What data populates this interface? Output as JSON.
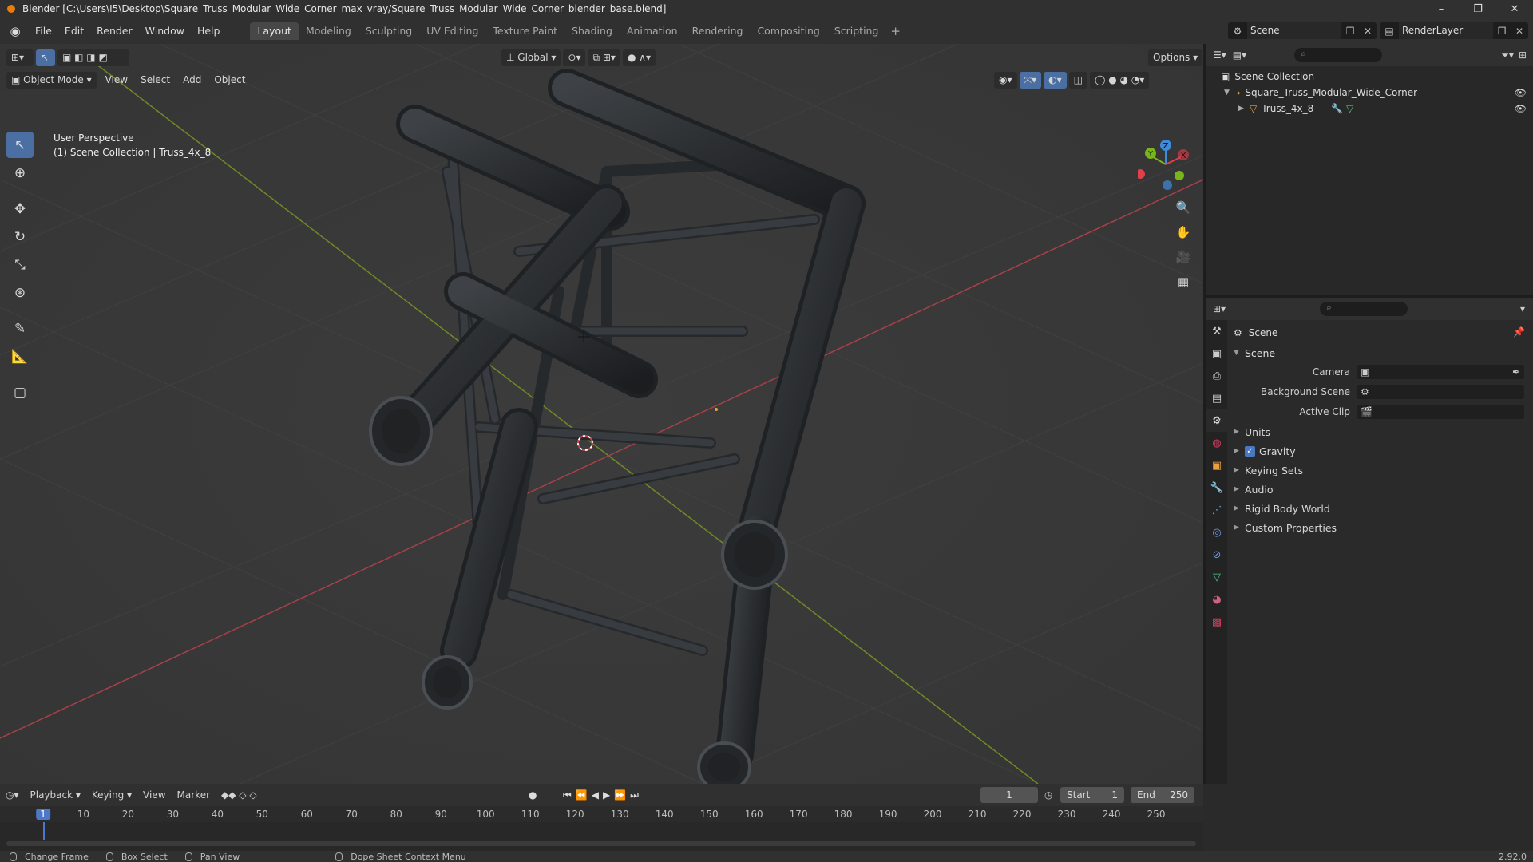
{
  "window": {
    "title": "Blender [C:\\Users\\I5\\Desktop\\Square_Truss_Modular_Wide_Corner_max_vray/Square_Truss_Modular_Wide_Corner_blender_base.blend]",
    "minimize": "–",
    "maximize": "❐",
    "close": "✕"
  },
  "menus": [
    "File",
    "Edit",
    "Render",
    "Window",
    "Help"
  ],
  "workspaces": [
    "Layout",
    "Modeling",
    "Sculpting",
    "UV Editing",
    "Texture Paint",
    "Shading",
    "Animation",
    "Rendering",
    "Compositing",
    "Scripting"
  ],
  "active_workspace": "Layout",
  "add_workspace": "+",
  "scene_selector": {
    "scene": "Scene",
    "view_layer": "RenderLayer"
  },
  "viewport": {
    "mode": "Object Mode",
    "menus": [
      "View",
      "Select",
      "Add",
      "Object"
    ],
    "orientation": "Global",
    "options": "Options",
    "overlay_line1": "User Perspective",
    "overlay_line2": "(1) Scene Collection | Truss_4x_8",
    "gizmo": {
      "x_label": "X",
      "y_label": "Y",
      "z_label": "Z",
      "x_color": "#e0404b",
      "y_color": "#7ab41b",
      "z_color": "#3f8bdb"
    }
  },
  "outliner": {
    "root": "Scene Collection",
    "items": [
      {
        "label": "Square_Truss_Modular_Wide_Corner",
        "depth": 1
      },
      {
        "label": "Truss_4x_8",
        "depth": 2
      }
    ]
  },
  "properties": {
    "header": "Scene",
    "panel": "Scene",
    "fields": [
      {
        "label": "Camera",
        "value": ""
      },
      {
        "label": "Background Scene",
        "value": ""
      },
      {
        "label": "Active Clip",
        "value": ""
      }
    ],
    "collapsed_panels": [
      "Units",
      "Gravity",
      "Keying Sets",
      "Audio",
      "Rigid Body World",
      "Custom Properties"
    ],
    "gravity_checked": true
  },
  "timeline": {
    "menus": [
      "Playback",
      "Keying",
      "View",
      "Marker"
    ],
    "current_frame": "1",
    "start_label": "Start",
    "start": "1",
    "end_label": "End",
    "end": "250",
    "ticks": [
      "1",
      "10",
      "20",
      "30",
      "40",
      "50",
      "60",
      "70",
      "80",
      "90",
      "100",
      "110",
      "120",
      "130",
      "140",
      "150",
      "160",
      "170",
      "180",
      "190",
      "200",
      "210",
      "220",
      "230",
      "240",
      "250"
    ]
  },
  "statusbar": {
    "items": [
      "Change Frame",
      "Box Select",
      "Pan View",
      "Dope Sheet Context Menu"
    ],
    "version": "2.92.0"
  },
  "colors": {
    "accent": "#4b6fa3",
    "header": "#303030",
    "viewport_bg": "#393939",
    "x_axis": "#c0404b",
    "y_axis": "#7a9a1b"
  }
}
